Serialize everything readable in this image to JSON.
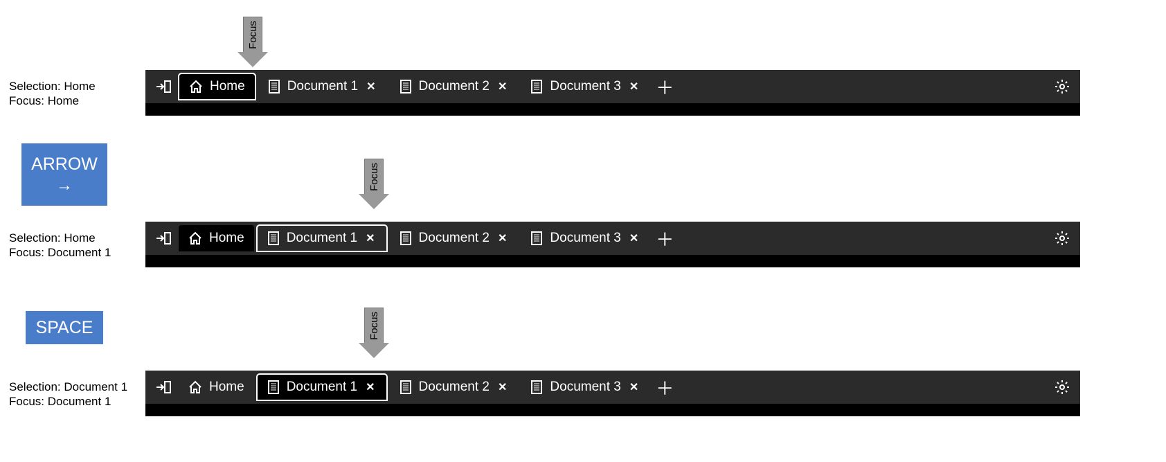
{
  "focusLabel": "Focus",
  "keys": {
    "arrow": "ARROW",
    "arrowGlyph": "→",
    "space": "SPACE"
  },
  "states": [
    {
      "selectionLine": "Selection: Home",
      "focusLine": "Focus: Home",
      "tabs": [
        {
          "label": "Home",
          "icon": "home",
          "closable": false,
          "selected": true,
          "focused": true
        },
        {
          "label": "Document 1",
          "icon": "doc",
          "closable": true,
          "selected": false,
          "focused": false
        },
        {
          "label": "Document 2",
          "icon": "doc",
          "closable": true,
          "selected": false,
          "focused": false
        },
        {
          "label": "Document 3",
          "icon": "doc",
          "closable": true,
          "selected": false,
          "focused": false
        }
      ]
    },
    {
      "selectionLine": "Selection: Home",
      "focusLine": "Focus: Document 1",
      "tabs": [
        {
          "label": "Home",
          "icon": "home",
          "closable": false,
          "selected": true,
          "focused": false
        },
        {
          "label": "Document 1",
          "icon": "doc",
          "closable": true,
          "selected": false,
          "focused": true
        },
        {
          "label": "Document 2",
          "icon": "doc",
          "closable": true,
          "selected": false,
          "focused": false
        },
        {
          "label": "Document 3",
          "icon": "doc",
          "closable": true,
          "selected": false,
          "focused": false
        }
      ]
    },
    {
      "selectionLine": "Selection: Document 1",
      "focusLine": "Focus: Document 1",
      "tabs": [
        {
          "label": "Home",
          "icon": "home",
          "closable": false,
          "selected": false,
          "focused": false
        },
        {
          "label": "Document 1",
          "icon": "doc",
          "closable": true,
          "selected": true,
          "focused": true
        },
        {
          "label": "Document 2",
          "icon": "doc",
          "closable": true,
          "selected": false,
          "focused": false
        },
        {
          "label": "Document 3",
          "icon": "doc",
          "closable": true,
          "selected": false,
          "focused": false
        }
      ]
    }
  ],
  "closeGlyph": "✕",
  "addGlyph": "＋"
}
